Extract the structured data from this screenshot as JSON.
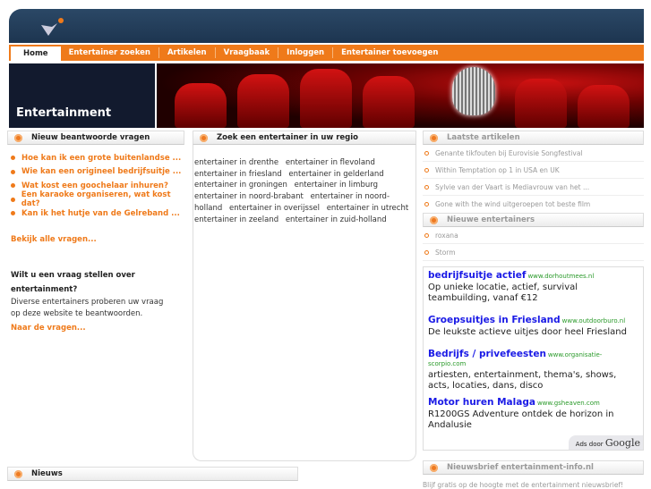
{
  "nav": {
    "items": [
      "Home",
      "Entertainer zoeken",
      "Artikelen",
      "Vraagbaak",
      "Inloggen",
      "Entertainer toevoegen"
    ]
  },
  "hero": {
    "title": "Entertainment"
  },
  "left": {
    "heading": "Nieuw beantwoorde vragen",
    "questions": [
      "Hoe kan ik een grote buitenlandse ...",
      "Wie kan een origineel bedrijfsuitje ...",
      "Wat kost een goochelaar inhuren?",
      "Een karaoke organiseren, wat kost dat?",
      "Kan ik het hutje van de Gelreband ..."
    ],
    "all_link": "Bekijk alle vragen...",
    "ask_title": "Wilt u een vraag stellen over entertainment?",
    "ask_text": "Diverse entertainers proberen uw vraag op deze website te beantwoorden.",
    "ask_link": "Naar de vragen...",
    "news_heading": "Nieuws"
  },
  "middle": {
    "heading": "Zoek een entertainer in uw regio",
    "regions": [
      "entertainer in drenthe",
      "entertainer in flevoland",
      "entertainer in friesland",
      "entertainer in gelderland",
      "entertainer in groningen",
      "entertainer in limburg",
      "entertainer in noord-brabant",
      "entertainer in noord-holland",
      "entertainer in overijssel",
      "entertainer in utrecht",
      "entertainer in zeeland",
      "entertainer in zuid-holland"
    ]
  },
  "right": {
    "articles_heading": "Laatste artikelen",
    "articles": [
      "Genante tikfouten bij Eurovisie Songfestival",
      "Within Temptation op 1 in USA en UK",
      "Sylvie van der Vaart is Mediavrouw van het ...",
      "Gone with the wind uitgeroepen tot beste film"
    ],
    "entertainers_heading": "Nieuwe entertainers",
    "entertainers": [
      "roxana",
      "Storm"
    ],
    "ads": [
      {
        "title": "bedrijfsuitje actief",
        "url": "www.dorhoutmees.nl",
        "text": "Op unieke locatie, actief, survival teambuilding, vanaf €12"
      },
      {
        "title": "Groepsuitjes in Friesland",
        "url": "www.outdoorburo.nl",
        "text": "De leukste actieve uitjes door heel Friesland"
      },
      {
        "title": "Bedrijfs / privefeesten",
        "url": "www.organisatie-scorpio.com",
        "text": "artiesten, entertainment, thema's, shows, acts, locaties, dans, disco"
      },
      {
        "title": "Motor huren Malaga",
        "url": "www.gsheaven.com",
        "text": "R1200GS Adventure ontdek de horizon in Andalusie"
      }
    ],
    "ads_by": "Ads door",
    "ads_brand": "Google",
    "newsletter_heading": "Nieuwsbrief entertainment-info.nl",
    "newsletter_text": "Blijf gratis op de hoogte met de entertainment nieuwsbrief!"
  },
  "colors": {
    "accent": "#ef7a1a",
    "header": "#1d3550"
  }
}
